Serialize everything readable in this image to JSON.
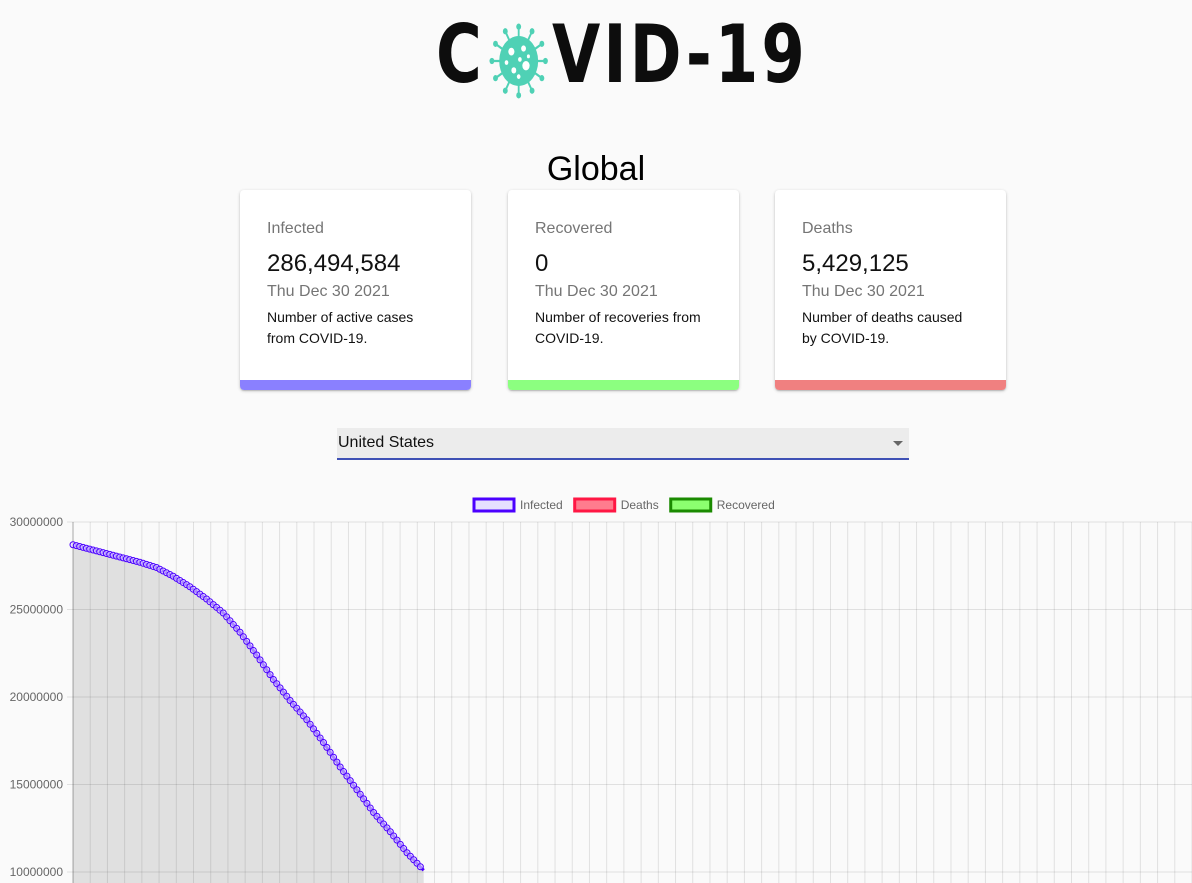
{
  "logo": {
    "text_left": "C",
    "text_right": "VID-19",
    "virus_color": "#4fd1b5"
  },
  "region": {
    "title": "Global"
  },
  "cards": [
    {
      "title": "Infected",
      "value": "286,494,584",
      "date": "Thu Dec 30 2021",
      "desc": "Number of active cases from COVID-19.",
      "color": "#8a80ff"
    },
    {
      "title": "Recovered",
      "value": "0",
      "date": "Thu Dec 30 2021",
      "desc": "Number of recoveries from COVID-19.",
      "color": "#8cff80"
    },
    {
      "title": "Deaths",
      "value": "5,429,125",
      "date": "Thu Dec 30 2021",
      "desc": "Number of deaths caused by COVID-19.",
      "color": "#f08080"
    }
  ],
  "country_select": {
    "value": "United States"
  },
  "chart_data": {
    "type": "line",
    "legend": [
      {
        "name": "Infected",
        "border": "#4b00ff",
        "fill": "#e6e0ff"
      },
      {
        "name": "Deaths",
        "border": "#ff1744",
        "fill": "#ff7c8e"
      },
      {
        "name": "Recovered",
        "border": "#1a8a00",
        "fill": "#8cff70"
      }
    ],
    "legend_position": "top",
    "yticks": [
      "30000000",
      "25000000",
      "20000000",
      "15000000",
      "10000000"
    ],
    "ylim_visible": [
      10000000,
      30000000
    ],
    "grid": true,
    "x_gridlines": 65,
    "series": [
      {
        "name": "Infected",
        "fill": true,
        "values": [
          28700000,
          28450000,
          28200000,
          27950000,
          27700000,
          27400000,
          26900000,
          26300000,
          25600000,
          24800000,
          23700000,
          22400000,
          21000000,
          19800000,
          18700000,
          17400000,
          16000000,
          14700000,
          13400000,
          12300000,
          11100000,
          10100000
        ]
      }
    ]
  }
}
